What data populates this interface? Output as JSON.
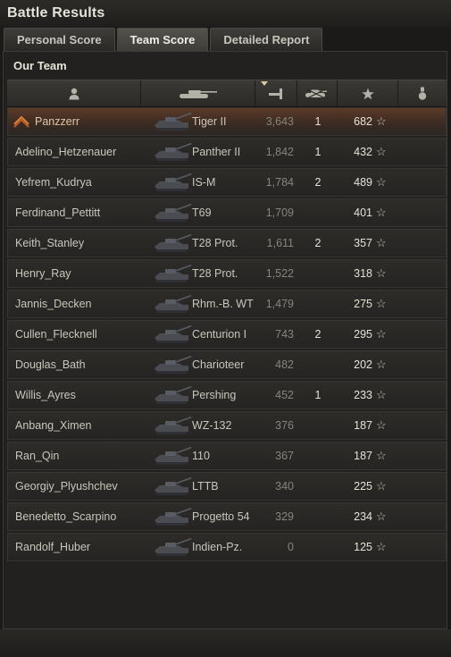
{
  "window": {
    "title": "Battle Results"
  },
  "tabs": [
    {
      "label": "Personal Score",
      "active": false
    },
    {
      "label": "Team Score",
      "active": true
    },
    {
      "label": "Detailed Report",
      "active": false
    }
  ],
  "team": {
    "title": "Our Team"
  },
  "columns": {
    "player": "person-icon",
    "tank": "tank-icon",
    "damage": "damage-icon",
    "kills": "kills-icon",
    "xp": "star-icon",
    "medal": "medal-icon",
    "sorted_by": "damage"
  },
  "rows": [
    {
      "name": "Panzzerr",
      "tank": "Tiger II",
      "damage": "3,643",
      "kills": "1",
      "xp": "682",
      "is_player": true
    },
    {
      "name": "Adelino_Hetzenauer",
      "tank": "Panther II",
      "damage": "1,842",
      "kills": "1",
      "xp": "432"
    },
    {
      "name": "Yefrem_Kudrya",
      "tank": "IS-M",
      "damage": "1,784",
      "kills": "2",
      "xp": "489"
    },
    {
      "name": "Ferdinand_Pettitt",
      "tank": "T69",
      "damage": "1,709",
      "kills": "",
      "xp": "401"
    },
    {
      "name": "Keith_Stanley",
      "tank": "T28 Prot.",
      "damage": "1,611",
      "kills": "2",
      "xp": "357"
    },
    {
      "name": "Henry_Ray",
      "tank": "T28 Prot.",
      "damage": "1,522",
      "kills": "",
      "xp": "318"
    },
    {
      "name": "Jannis_Decken",
      "tank": "Rhm.-B. WT",
      "damage": "1,479",
      "kills": "",
      "xp": "275"
    },
    {
      "name": "Cullen_Flecknell",
      "tank": "Centurion I",
      "damage": "743",
      "kills": "2",
      "xp": "295"
    },
    {
      "name": "Douglas_Bath",
      "tank": "Charioteer",
      "damage": "482",
      "kills": "",
      "xp": "202"
    },
    {
      "name": "Willis_Ayres",
      "tank": "Pershing",
      "damage": "452",
      "kills": "1",
      "xp": "233"
    },
    {
      "name": "Anbang_Ximen",
      "tank": "WZ-132",
      "damage": "376",
      "kills": "",
      "xp": "187"
    },
    {
      "name": "Ran_Qin",
      "tank": "110",
      "damage": "367",
      "kills": "",
      "xp": "187"
    },
    {
      "name": "Georgiy_Plyushchev",
      "tank": "LTTB",
      "damage": "340",
      "kills": "",
      "xp": "225"
    },
    {
      "name": "Benedetto_Scarpino",
      "tank": "Progetto 54",
      "damage": "329",
      "kills": "",
      "xp": "234"
    },
    {
      "name": "Randolf_Huber",
      "tank": "Indien-Pz.",
      "damage": "0",
      "kills": "",
      "xp": "125"
    }
  ],
  "star_glyph": "☆"
}
